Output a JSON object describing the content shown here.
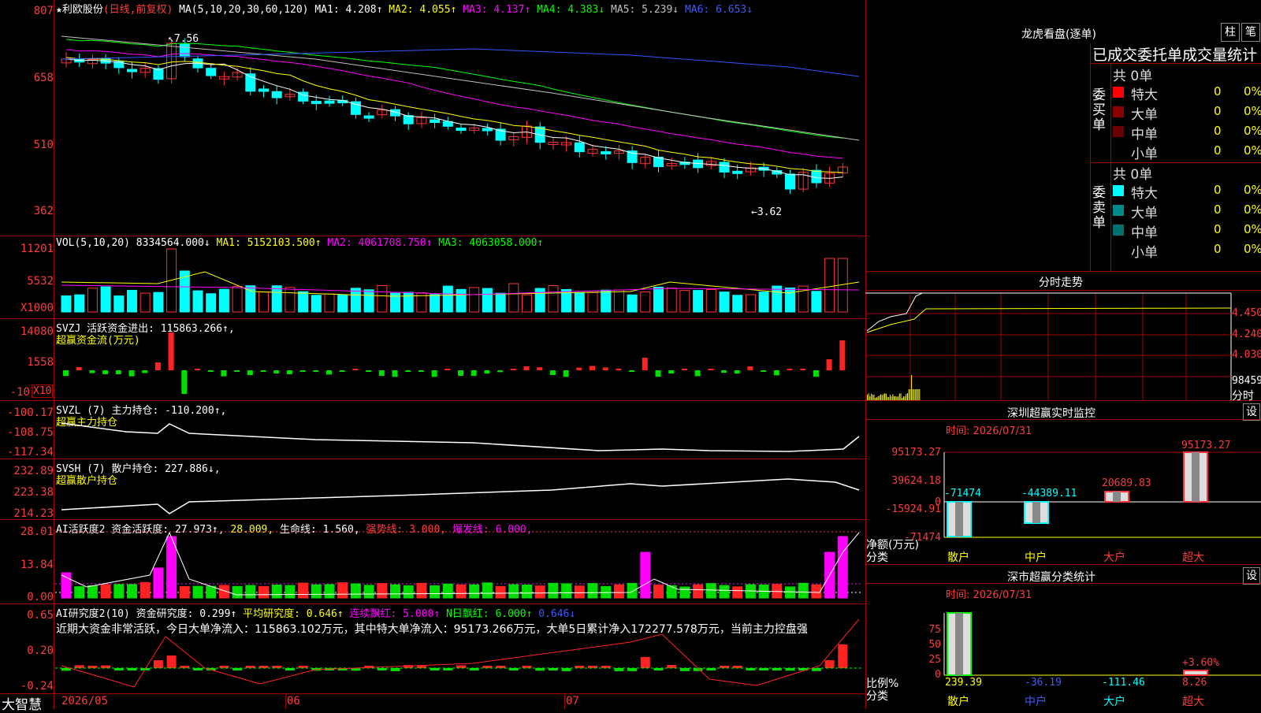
{
  "colors": {
    "up": "#ff3333",
    "down": "#00ffff",
    "ma1": "#ffffff",
    "ma2": "#ffff00",
    "ma3": "#ff00ff",
    "ma4": "#00ff00",
    "ma5": "#c0c0c0",
    "ma6": "#3355ff",
    "grid": "#a00000"
  },
  "price": {
    "title": "★利欧股份",
    "mode": "(日线,前复权)",
    "ma_label": "MA(5,10,20,30,60,120)",
    "ma1": "MA1: 4.208↑",
    "ma2": "MA2: 4.055↑",
    "ma3": "MA3: 4.137↑",
    "ma4": "MA4: 4.383↓",
    "ma5": "MA5: 5.239↓",
    "ma6": "MA6: 6.653↓",
    "y_ticks": [
      "807",
      "658",
      "510",
      "362"
    ],
    "high_mark": "7.56",
    "low_mark": "3.62"
  },
  "vol": {
    "title": "VOL(5,10,20)",
    "value": "8334564.000↓",
    "ma1": "MA1: 5152103.500↑",
    "ma2": "MA2: 4061708.750↑",
    "ma3": "MA3: 4063058.000↑",
    "y_ticks": [
      "11201",
      "5532"
    ],
    "unit": "X1000"
  },
  "svzj": {
    "title": "SVZJ  活跃资金进出: 115863.266↑,",
    "sub": "超赢资金流(万元)",
    "y_ticks": [
      "14080",
      "1558",
      "-10"
    ],
    "unit": "X10"
  },
  "svzl": {
    "title": "SVZL (7) 主力持仓: -110.200↑,",
    "sub": "超赢主力持仓",
    "y_ticks": [
      "-100.17",
      "-108.75",
      "-117.34"
    ]
  },
  "svsh": {
    "title": "SVSH (7) 散户持仓: 227.886↓,",
    "sub": "超赢散户持仓",
    "y_ticks": [
      "232.89",
      "223.38",
      "214.23"
    ]
  },
  "ai1": {
    "title": "AI活跃度2 资金活跃度: 27.973↑,",
    "v1": "28.009,",
    "v2": "生命线: 1.560,",
    "v3": "强势线: 3.000,",
    "v4": "爆发线: 6.000,",
    "y_ticks": [
      "28.01",
      "13.84",
      "0.00"
    ]
  },
  "ai2": {
    "title": "AI研究度2(10) 资金研究度: 0.299↑",
    "v1": "平均研究度: 0.646↑",
    "v2": "连续飘红: 5.000↑",
    "v3": "N日飘红: 6.000↑",
    "v4": "0.646↓",
    "note": "近期大资金非常活跃，今日大单净流入：115863.102万元，其中特大单净流入：95173.266万元，大单5日累计净入172277.578万元，当前主力控盘强",
    "y_ticks": [
      "0.65",
      "0.20",
      "-0.24"
    ]
  },
  "x_axis": {
    "brand": "大智慧",
    "labels": [
      "2026/05",
      "06",
      "07"
    ]
  },
  "right": {
    "lhb_title": "龙虎看盘(逐单)",
    "btn_col": "柱",
    "btn_pen": "笔",
    "order_title": "已成交委托单成交量统计",
    "buy": {
      "label": "委买单",
      "total": "共 0单",
      "rows": [
        {
          "name": "特大",
          "v": "0",
          "p": "0%",
          "c": "#ff0000"
        },
        {
          "name": "大单",
          "v": "0",
          "p": "0%",
          "c": "#8b0000"
        },
        {
          "name": "中单",
          "v": "0",
          "p": "0%",
          "c": "#6b0000"
        },
        {
          "name": "小单",
          "v": "0",
          "p": "0%",
          "c": ""
        }
      ]
    },
    "sell": {
      "label": "委卖单",
      "total": "共 0单",
      "rows": [
        {
          "name": "特大",
          "v": "0",
          "p": "0%",
          "c": "#00ffff"
        },
        {
          "name": "大单",
          "v": "0",
          "p": "0%",
          "c": "#008b8b"
        },
        {
          "name": "中单",
          "v": "0",
          "p": "0%",
          "c": "#007070"
        },
        {
          "name": "小单",
          "v": "0",
          "p": "0%",
          "c": ""
        }
      ]
    },
    "fs_title": "分时走势",
    "fs_ticks": [
      "4.450",
      "4.240",
      "4.030"
    ],
    "fs_vol": "98459",
    "fs_unit": "分时",
    "sz1_title": "深圳超赢实时监控",
    "sz1_btn": "设",
    "sz1_time": "时间: 2026/07/31",
    "sz1_ticks": [
      "95173.27",
      "39624.18",
      "0",
      "-15924.91",
      "-71474"
    ],
    "sz1_side": "净额(万元)",
    "sz1_side2": "分类",
    "sz1_vals": [
      "-71474",
      "-44389.11",
      "20689.83",
      "95173.27"
    ],
    "cats": [
      "散户",
      "中户",
      "大户",
      "超大"
    ],
    "sz2_title": "深市超赢分类统计",
    "sz2_btn": "设",
    "sz2_time": "时间: 2026/07/31",
    "sz2_ticks": [
      "75",
      "50",
      "25",
      "0"
    ],
    "sz2_side": "比例%",
    "sz2_side2": "分类",
    "sz2_vals": [
      "239.39",
      "-36.19",
      "-111.46",
      "8.26"
    ],
    "sz2_pct": "+3.60%"
  }
}
